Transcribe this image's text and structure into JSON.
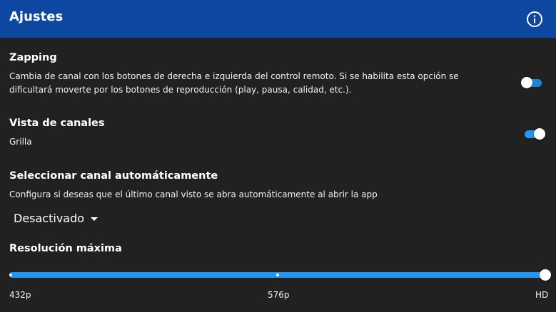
{
  "header": {
    "title": "Ajustes",
    "info_icon": "info-circle-icon"
  },
  "settings": {
    "zapping": {
      "title": "Zapping",
      "description_line1": "Cambia de canal con los botones de derecha e izquierda del control remoto. Si se habilita esta opción se",
      "description_line2": "dificultará moverte por los botones de reproducción (play, pausa, calidad, etc.).",
      "enabled": false
    },
    "channel_view": {
      "title": "Vista de canales",
      "value": "Grilla",
      "enabled": true
    },
    "auto_channel": {
      "title": "Seleccionar canal automáticamente",
      "description": "Configura si deseas que el último canal visto se abra automáticamente al abrir la app",
      "selected_option": "Desactivado"
    },
    "max_resolution": {
      "title": "Resolución máxima",
      "options": [
        "432p",
        "576p",
        "HD"
      ],
      "selected": "HD",
      "selected_fraction": 1.0
    }
  },
  "colors": {
    "header_bg": "#0d47a1",
    "background": "#212121",
    "accent": "#2196f3"
  }
}
